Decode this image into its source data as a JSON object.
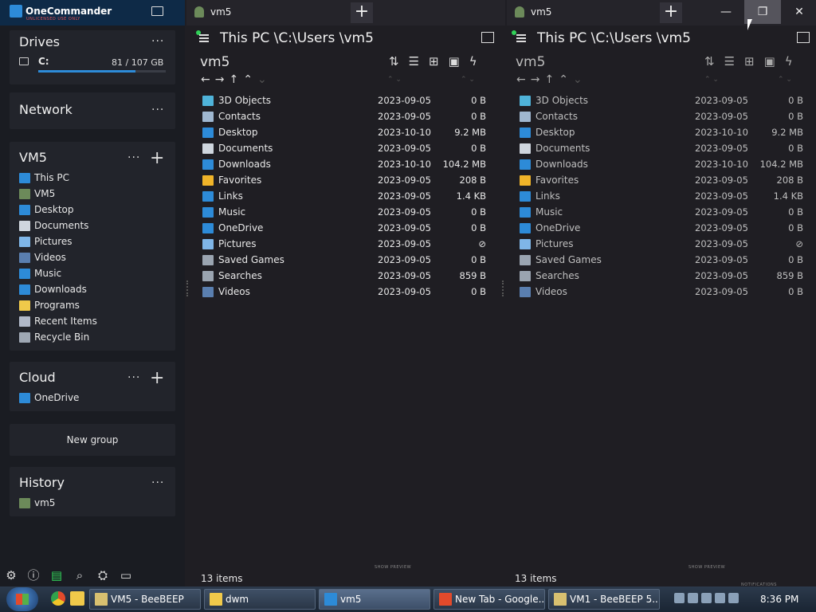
{
  "app": {
    "title": "OneCommander",
    "subtitle": "UNLICENSED USE ONLY"
  },
  "sidebar": {
    "drives": {
      "title": "Drives",
      "more": "···",
      "drive_label": "C:",
      "drive_size": "81 / 107 GB",
      "used_fraction": 0.76
    },
    "network": {
      "title": "Network",
      "more": "···"
    },
    "vm5": {
      "title": "VM5",
      "more": "···",
      "add": "+",
      "items": [
        {
          "label": "This PC",
          "icon": "monitor-icon",
          "color": "#2d8bd8"
        },
        {
          "label": "VM5",
          "icon": "user-icon",
          "color": "#6c8a5a"
        },
        {
          "label": "Desktop",
          "icon": "desktop-icon",
          "color": "#2d8bd8"
        },
        {
          "label": "Documents",
          "icon": "document-icon",
          "color": "#cfd6de"
        },
        {
          "label": "Pictures",
          "icon": "pictures-icon",
          "color": "#7fb6e8"
        },
        {
          "label": "Videos",
          "icon": "videos-icon",
          "color": "#5a7fb0"
        },
        {
          "label": "Music",
          "icon": "music-icon",
          "color": "#2d8bd8"
        },
        {
          "label": "Downloads",
          "icon": "download-icon",
          "color": "#2d8bd8"
        },
        {
          "label": "Programs",
          "icon": "folder-icon",
          "color": "#f0c94a"
        },
        {
          "label": "Recent Items",
          "icon": "recent-icon",
          "color": "#b0b8c8"
        },
        {
          "label": "Recycle Bin",
          "icon": "recycle-bin-icon",
          "color": "#9fa8b4"
        }
      ]
    },
    "cloud": {
      "title": "Cloud",
      "more": "···",
      "add": "+",
      "items": [
        {
          "label": "OneDrive",
          "icon": "onedrive-icon",
          "color": "#2d8bd8"
        }
      ]
    },
    "new_group": "New group",
    "history": {
      "title": "History",
      "more": "···",
      "items": [
        {
          "label": "vm5",
          "icon": "user-icon",
          "color": "#6c8a5a"
        }
      ]
    }
  },
  "panes": [
    {
      "tab": "vm5",
      "tab_add": "+",
      "address": "This PC \\C:\\Users \\vm5",
      "folder": "vm5",
      "status": "13 items",
      "preview": "SHOW PREVIEW"
    },
    {
      "tab": "vm5",
      "tab_add": "+",
      "address": "This PC \\C:\\Users \\vm5",
      "folder": "vm5",
      "status": "13 items",
      "preview": "SHOW PREVIEW",
      "notifications": "NOTIFICATIONS"
    }
  ],
  "files": [
    {
      "name": "3D Objects",
      "date": "2023-09-05",
      "size": "0 B",
      "icon": "3d-objects-icon",
      "color": "#4fb3d9"
    },
    {
      "name": "Contacts",
      "date": "2023-09-05",
      "size": "0 B",
      "icon": "contacts-icon",
      "color": "#9fb7d0"
    },
    {
      "name": "Desktop",
      "date": "2023-10-10",
      "size": "9.2 MB",
      "icon": "desktop-icon",
      "color": "#2d8bd8"
    },
    {
      "name": "Documents",
      "date": "2023-09-05",
      "size": "0 B",
      "icon": "document-icon",
      "color": "#cfd6de"
    },
    {
      "name": "Downloads",
      "date": "2023-10-10",
      "size": "104.2 MB",
      "icon": "download-icon",
      "color": "#2d8bd8"
    },
    {
      "name": "Favorites",
      "date": "2023-09-05",
      "size": "208 B",
      "icon": "star-icon",
      "color": "#f0b429"
    },
    {
      "name": "Links",
      "date": "2023-09-05",
      "size": "1.4 KB",
      "icon": "link-icon",
      "color": "#2d8bd8"
    },
    {
      "name": "Music",
      "date": "2023-09-05",
      "size": "0 B",
      "icon": "music-icon",
      "color": "#2d8bd8"
    },
    {
      "name": "OneDrive",
      "date": "2023-09-05",
      "size": "0 B",
      "icon": "onedrive-icon",
      "color": "#2d8bd8"
    },
    {
      "name": "Pictures",
      "date": "2023-09-05",
      "size": "⊘",
      "icon": "pictures-icon",
      "color": "#7fb6e8"
    },
    {
      "name": "Saved Games",
      "date": "2023-09-05",
      "size": "0 B",
      "icon": "saved-games-icon",
      "color": "#9aa4b0"
    },
    {
      "name": "Searches",
      "date": "2023-09-05",
      "size": "859 B",
      "icon": "search-icon",
      "color": "#9aa4b0"
    },
    {
      "name": "Videos",
      "date": "2023-09-05",
      "size": "0 B",
      "icon": "videos-icon",
      "color": "#5a7fb0"
    }
  ],
  "window": {
    "minimize": "—",
    "restore": "❐",
    "close": "✕"
  },
  "taskbar": {
    "buttons": [
      {
        "label": "VM5 - BeeBEEP",
        "icon": "beebeep-icon",
        "color": "#d8c070"
      },
      {
        "label": "dwm",
        "icon": "folder-icon",
        "color": "#f0c94a"
      },
      {
        "label": "vm5",
        "icon": "onecommander-icon",
        "color": "#2d8bd8"
      },
      {
        "label": "New Tab - Google...",
        "icon": "chrome-icon",
        "color": "#e24a2b"
      },
      {
        "label": "VM1 - BeeBEEP 5....",
        "icon": "beebeep-icon",
        "color": "#d8c070"
      }
    ],
    "clock": "8:36 PM"
  }
}
